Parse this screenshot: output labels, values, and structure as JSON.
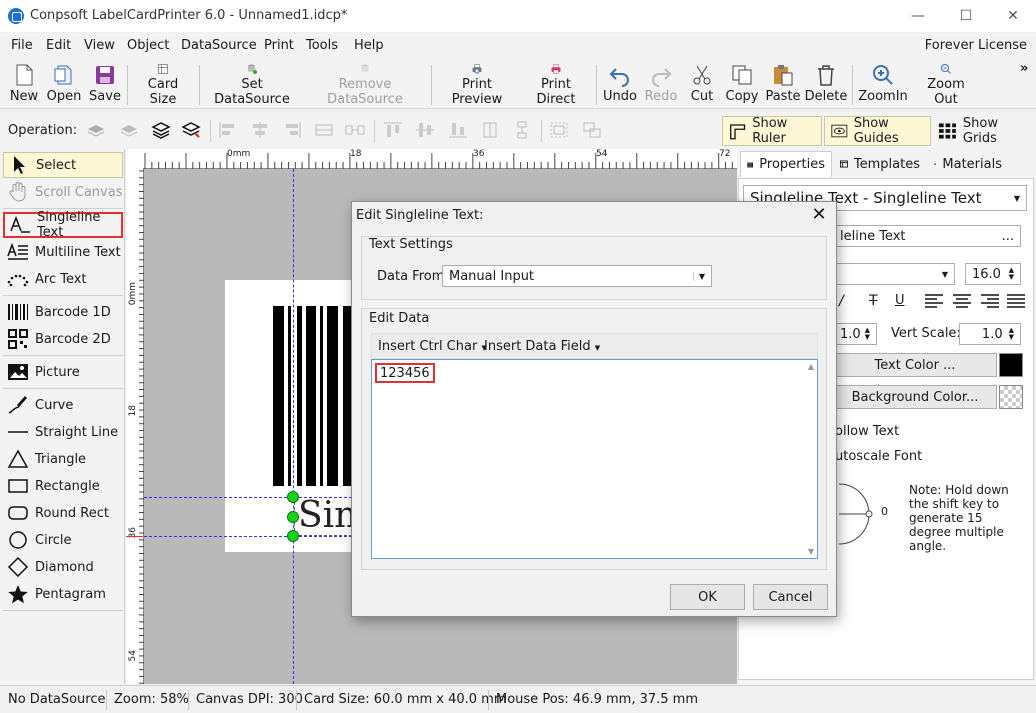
{
  "window": {
    "title": "Conpsoft LabelCardPrinter 6.0 - Unnamed1.idcp*",
    "minimize": "—",
    "maximize": "☐",
    "close": "✕"
  },
  "menu": {
    "items": [
      "File",
      "Edit",
      "View",
      "Object",
      "DataSource",
      "Print",
      "Tools",
      "Help"
    ],
    "license": "Forever License"
  },
  "toolbar": {
    "new": "New",
    "open": "Open",
    "save": "Save",
    "card_size": "Card Size",
    "set_datasource": "Set DataSource",
    "remove_datasource": "Remove DataSource",
    "print_preview": "Print Preview",
    "print_direct": "Print Direct",
    "undo": "Undo",
    "redo": "Redo",
    "cut": "Cut",
    "copy": "Copy",
    "paste": "Paste",
    "delete": "Delete",
    "zoom_in": "ZoomIn",
    "zoom_out": "Zoom Out",
    "more": "»"
  },
  "operation": {
    "label": "Operation:",
    "show_ruler": "Show Ruler",
    "show_guides": "Show Guides",
    "show_grids": "Show Grids"
  },
  "tools": {
    "select": "Select",
    "scroll_canvas": "Scroll Canvas",
    "singleline_text": "Singleline Text",
    "multiline_text": "Multiline Text",
    "arc_text": "Arc Text",
    "barcode_1d": "Barcode 1D",
    "barcode_2d": "Barcode 2D",
    "picture": "Picture",
    "curve": "Curve",
    "straight_line": "Straight Line",
    "triangle": "Triangle",
    "rectangle": "Rectangle",
    "round_rect": "Round Rect",
    "circle": "Circle",
    "diamond": "Diamond",
    "pentagram": "Pentagram"
  },
  "ruler": {
    "h_ticks": [
      "0mm",
      "18",
      "36",
      "54",
      "72"
    ],
    "v_ticks": [
      "0mm",
      "18",
      "36",
      "54"
    ]
  },
  "canvas": {
    "selected_text": "Sin"
  },
  "right_panel": {
    "tabs": {
      "properties": "Properties",
      "templates": "Templates",
      "materials": "Materials"
    },
    "object_select": "Singleline Text - Singleline Text",
    "name_field": "leline Text",
    "name_btn": "...",
    "font_size": "16.0",
    "style_italic": "/",
    "style_strike": "T",
    "style_underline": "U",
    "hscale": "1.0",
    "vert_scale_label": "Vert Scale:",
    "vscale": "1.0",
    "text_color": "Text Color ...",
    "background_color": "Background Color...",
    "follow_text": "ollow Text",
    "autoscale_font": "utoscale Font",
    "angle": "0",
    "note": "Note: Hold down the shift key to generate 15 degree multiple angle."
  },
  "dialog": {
    "title": "Edit Singleline Text:",
    "close": "✕",
    "text_settings": "Text Settings",
    "data_from_label": "Data From:",
    "data_from_value": "Manual Input",
    "edit_data": "Edit Data",
    "insert_ctrl_char": "Insert Ctrl Char",
    "insert_data_field": "Insert Data Field",
    "text_value": "123456",
    "ok": "OK",
    "cancel": "Cancel"
  },
  "status": {
    "datasource": "No DataSource",
    "zoom": "Zoom: 58%",
    "dpi": "Canvas DPI: 300",
    "card_size": "Card Size: 60.0 mm x 40.0 mm",
    "mouse_pos": "Mouse Pos: 46.9 mm, 37.5 mm"
  }
}
